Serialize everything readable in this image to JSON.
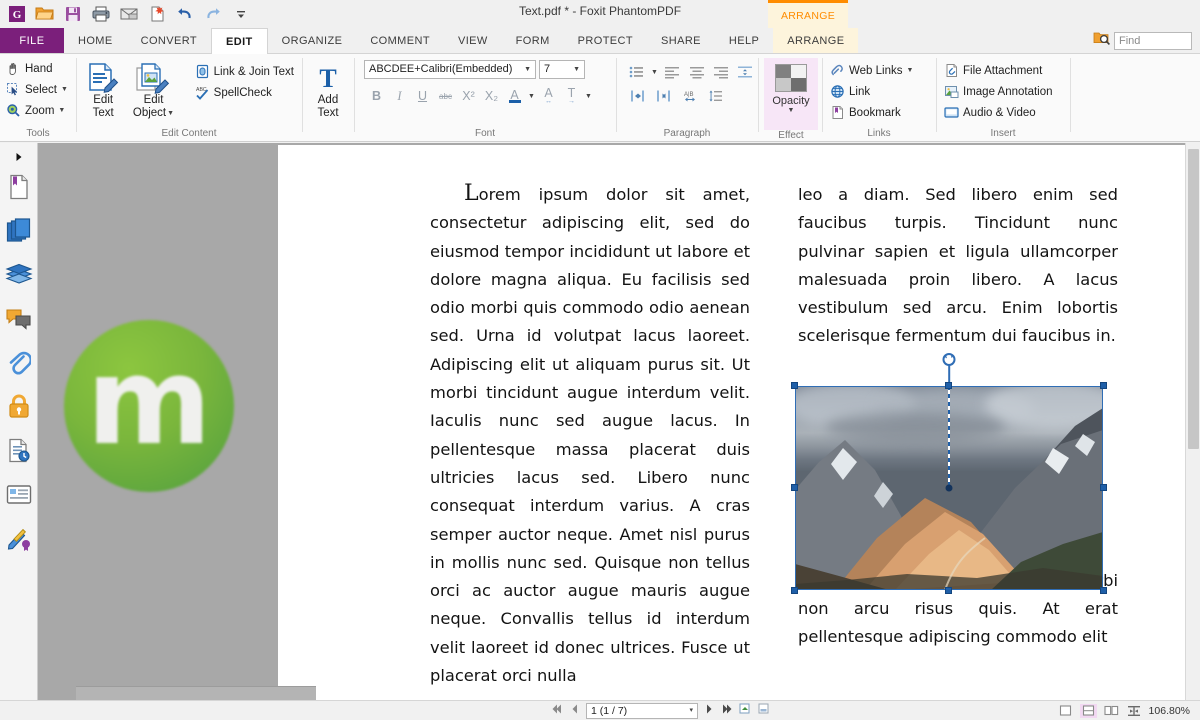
{
  "window": {
    "title": "Text.pdf * - Foxit PhantomPDF"
  },
  "quick_access": [
    {
      "name": "foxit-logo-icon",
      "label": "G"
    },
    {
      "name": "open-icon",
      "label": "Open"
    },
    {
      "name": "save-icon",
      "label": "Save"
    },
    {
      "name": "print-icon",
      "label": "Print"
    },
    {
      "name": "email-icon",
      "label": "Email"
    },
    {
      "name": "new-from-file-icon",
      "label": "New"
    },
    {
      "name": "undo-icon",
      "label": "Undo"
    },
    {
      "name": "redo-icon",
      "label": "Redo"
    },
    {
      "name": "customize-qat-icon",
      "label": "Customize"
    }
  ],
  "contextual_tab": {
    "label": "ARRANGE"
  },
  "tabs": [
    {
      "label": "FILE",
      "active": false
    },
    {
      "label": "HOME",
      "active": false
    },
    {
      "label": "CONVERT",
      "active": false
    },
    {
      "label": "EDIT",
      "active": true
    },
    {
      "label": "ORGANIZE",
      "active": false
    },
    {
      "label": "COMMENT",
      "active": false
    },
    {
      "label": "VIEW",
      "active": false
    },
    {
      "label": "FORM",
      "active": false
    },
    {
      "label": "PROTECT",
      "active": false
    },
    {
      "label": "SHARE",
      "active": false
    },
    {
      "label": "HELP",
      "active": false
    },
    {
      "label": "ARRANGE",
      "active": false
    }
  ],
  "find": {
    "placeholder": "Find",
    "value": ""
  },
  "ribbon": {
    "tools": {
      "caption": "Tools",
      "hand": "Hand",
      "select": "Select",
      "zoom": "Zoom"
    },
    "edit_content": {
      "caption": "Edit Content",
      "edit_text_line1": "Edit",
      "edit_text_line2": "Text",
      "edit_object_line1": "Edit",
      "edit_object_line2": "Object",
      "link_join_text": "Link & Join Text",
      "spellcheck": "SpellCheck"
    },
    "add_text": {
      "line1": "Add",
      "line2": "Text"
    },
    "font": {
      "caption": "Font",
      "family": "ABCDEE+Calibri(Embedded)",
      "size": "7",
      "bold": "B",
      "italic": "I",
      "underline": "U",
      "strikethrough": "abc",
      "superscript": "X²",
      "subscript": "X₂",
      "font_color": "A",
      "char_spacing": "A",
      "text_scale": "T"
    },
    "paragraph": {
      "caption": "Paragraph",
      "buttons": [
        "bullet-list",
        "align-left",
        "align-center",
        "align-right",
        "line-spacing",
        "increase-indent",
        "decrease-indent",
        "paragraph-spacing",
        "list-spacing"
      ]
    },
    "effect": {
      "caption": "Effect",
      "opacity": "Opacity"
    },
    "links": {
      "caption": "Links",
      "web_links": "Web Links",
      "link": "Link",
      "bookmark": "Bookmark"
    },
    "insert": {
      "caption": "Insert",
      "file_attachment": "File Attachment",
      "image_annotation": "Image Annotation",
      "audio_video": "Audio & Video"
    }
  },
  "navpanel": {
    "expand_label": "Expand panel",
    "items": [
      {
        "name": "bookmarks-panel-icon",
        "label": "Bookmarks"
      },
      {
        "name": "page-thumbnails-panel-icon",
        "label": "Page Thumbnails"
      },
      {
        "name": "layers-panel-icon",
        "label": "Layers"
      },
      {
        "name": "comments-panel-icon",
        "label": "Comments"
      },
      {
        "name": "attachments-panel-icon",
        "label": "Attachments"
      },
      {
        "name": "security-panel-icon",
        "label": "Security"
      },
      {
        "name": "document-history-panel-icon",
        "label": "Document History"
      },
      {
        "name": "fields-panel-icon",
        "label": "Fields"
      },
      {
        "name": "digital-signature-panel-icon",
        "label": "Digital Signatures"
      }
    ]
  },
  "document": {
    "watermark_logo": "m",
    "left_column": {
      "dropcap": "L",
      "body": "orem ipsum dolor sit amet, consectetur adipiscing elit, sed do eiusmod tempor incididunt ut labore et dolore magna aliqua. Eu facilisis sed odio morbi quis commodo odio aenean sed. Urna id volutpat lacus laoreet. Adipiscing elit ut aliquam purus sit. Ut morbi tincidunt augue interdum velit. Iaculis nunc sed augue lacus. In pellentesque massa placerat duis ultricies lacus sed. Libero nunc consequat interdum varius. A cras semper auctor neque. Amet nisl purus in mollis nunc sed. Quisque non tellus orci ac auctor augue mauris augue neque. Convallis tellus id interdum velit laoreet id donec ultrices. Fusce ut placerat orci nulla"
    },
    "right_column": {
      "paragraph_before": "leo a diam. Sed libero enim sed faucibus turpis. Tincidunt nunc pulvinar sapien et ligula ullamcorper malesuada proin libero. A lacus vestibulum sed arcu. Enim lobortis scelerisque fermentum dui faucibus in.",
      "paragraph_after": "Amet porttitor eget dolor morbi non arcu risus quis. At erat pellentesque adipiscing commodo elit"
    },
    "selected_image": {
      "name": "mountain-landscape-image",
      "alt": "Mountain landscape with clouds"
    }
  },
  "statusbar": {
    "page_indicator": "1 (1 / 7)",
    "zoom_level": "106.80%",
    "nav_buttons": [
      {
        "name": "first-page-button",
        "label": "First page"
      },
      {
        "name": "previous-page-button",
        "label": "Previous page"
      },
      {
        "name": "next-page-button",
        "label": "Next page"
      },
      {
        "name": "last-page-button",
        "label": "Last page"
      },
      {
        "name": "previous-view-button",
        "label": "Previous view"
      },
      {
        "name": "next-view-button",
        "label": "Next view"
      }
    ],
    "view_modes": [
      {
        "name": "single-page-view-button",
        "label": "Single Page",
        "active": false
      },
      {
        "name": "continuous-view-button",
        "label": "Continuous",
        "active": true
      },
      {
        "name": "facing-view-button",
        "label": "Facing",
        "active": false
      },
      {
        "name": "split-view-button",
        "label": "Split",
        "active": false
      }
    ]
  },
  "colors": {
    "file_tab": "#7b1f7b",
    "contextual_accent": "#ff8c00",
    "selection": "#2f6db5",
    "effect_group": "#f7e6f7",
    "logo_green": "#6fb33f"
  }
}
